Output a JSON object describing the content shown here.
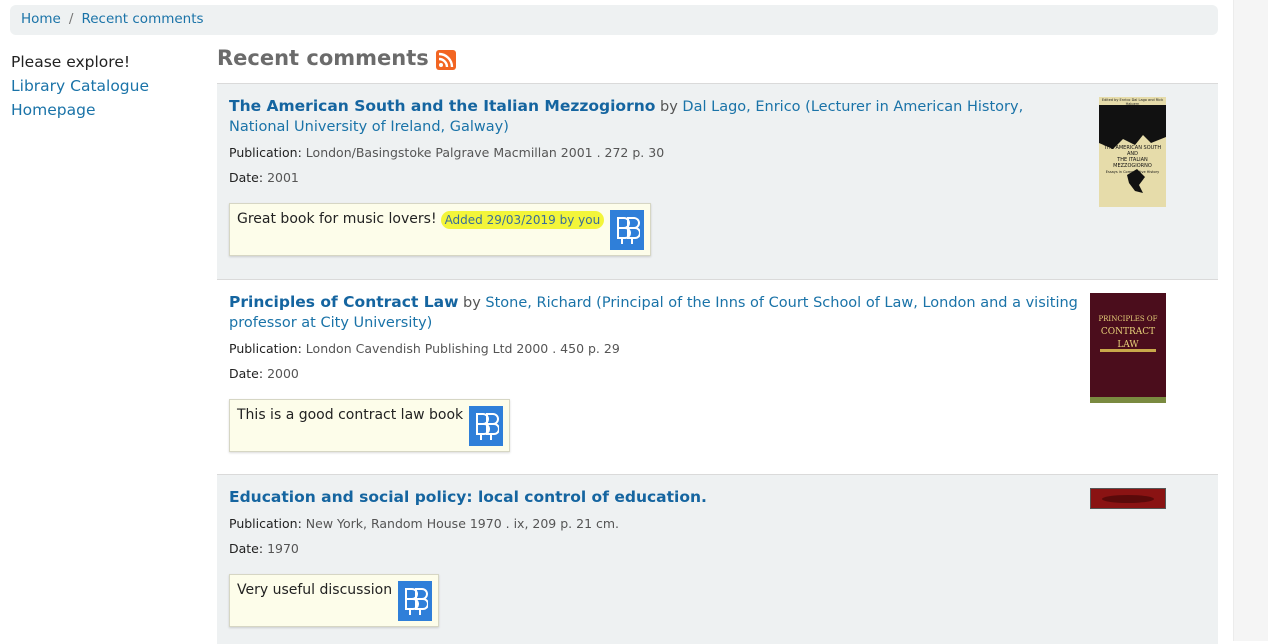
{
  "breadcrumb": {
    "home": "Home",
    "separator": "/",
    "current": "Recent comments"
  },
  "sidebar": {
    "intro": "Please explore!",
    "links": [
      "Library Catalogue",
      "Homepage"
    ]
  },
  "page": {
    "title": "Recent comments",
    "rss_icon": "rss-icon"
  },
  "comments": [
    {
      "title": "The American South and the Italian Mezzogiorno",
      "by": "by",
      "author": "Dal Lago, Enrico (Lecturer in American History, National University of Ireland, Galway)",
      "publication_label": "Publication:",
      "publication": "London/Basingstoke Palgrave Macmillan 2001 . 272 p. 30",
      "date_label": "Date:",
      "date": "2001",
      "comment": "Great book for music lovers!",
      "added": "Added 29/03/2019 by you",
      "cover_text": [
        "Edited by Enrico Dal Lago and Rick Halpern",
        "THE AMERICAN SOUTH AND",
        "THE ITALIAN MEZZOGIORNO",
        "Essays in Comparative History"
      ]
    },
    {
      "title": "Principles of Contract Law",
      "by": "by",
      "author": "Stone, Richard (Principal of the Inns of Court School of Law, London and a visiting professor at City University)",
      "publication_label": "Publication:",
      "publication": "London Cavendish Publishing Ltd 2000 . 450 p. 29",
      "date_label": "Date:",
      "date": "2000",
      "comment": "This is a good contract law book",
      "cover_text": [
        "PRINCIPLES OF",
        "CONTRACT",
        "LAW"
      ]
    },
    {
      "title": "Education and social policy: local control of education.",
      "publication_label": "Publication:",
      "publication": "New York, Random House 1970 . ix, 209 p. 21 cm.",
      "date_label": "Date:",
      "date": "1970",
      "comment": "Very useful discussion"
    }
  ],
  "colors": {
    "link": "#1a73a8",
    "title": "#1565a0",
    "highlight": "#f3f53a",
    "avatar": "#2f7fd9",
    "rss": "#f26522"
  }
}
